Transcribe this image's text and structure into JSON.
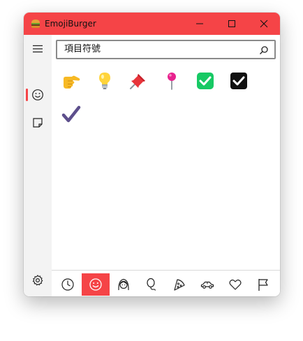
{
  "window": {
    "title": "EmojiBurger",
    "controls": [
      "minimize",
      "maximize",
      "close"
    ]
  },
  "search": {
    "value": "項目符號",
    "icon": "search-icon"
  },
  "sidebar": {
    "items": [
      {
        "name": "menu",
        "icon": "hamburger-menu-icon"
      },
      {
        "name": "emoji",
        "icon": "smiley-icon",
        "active": true
      },
      {
        "name": "notes",
        "icon": "note-icon"
      },
      {
        "name": "settings",
        "icon": "gear-icon"
      }
    ]
  },
  "results": [
    {
      "name": "backhand-index-pointing-right",
      "char": "👉"
    },
    {
      "name": "light-bulb",
      "char": "💡"
    },
    {
      "name": "pushpin",
      "char": "📌"
    },
    {
      "name": "round-pushpin",
      "char": "📍"
    },
    {
      "name": "check-mark-button",
      "char": "✅"
    },
    {
      "name": "check-box-with-check",
      "char": "☑"
    },
    {
      "name": "check-mark",
      "char": "✔"
    }
  ],
  "categories": [
    {
      "name": "recent",
      "icon": "clock-icon"
    },
    {
      "name": "smileys",
      "icon": "smiley-icon",
      "active": true
    },
    {
      "name": "people",
      "icon": "person-icon"
    },
    {
      "name": "activities",
      "icon": "balloon-icon"
    },
    {
      "name": "food",
      "icon": "pizza-icon"
    },
    {
      "name": "travel",
      "icon": "car-icon"
    },
    {
      "name": "symbols",
      "icon": "heart-icon"
    },
    {
      "name": "flags",
      "icon": "flag-icon"
    }
  ],
  "colors": {
    "accent": "#f54447",
    "sidebar_bg": "#f3f3f3"
  }
}
